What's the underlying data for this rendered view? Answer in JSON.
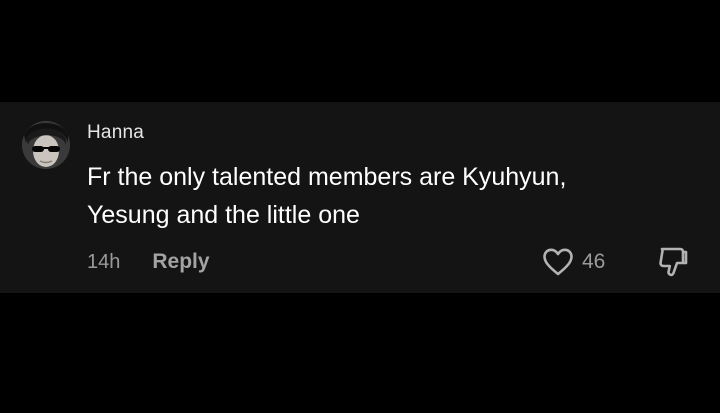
{
  "comment": {
    "username": "Hanna",
    "text_lines": [
      "Fr the only talented members are Kyuhyun,",
      "Yesung and the little one"
    ],
    "timestamp": "14h",
    "reply_label": "Reply",
    "like_count": "46",
    "icons": {
      "avatar": "avatar-photo",
      "like": "heart-outline-icon",
      "dislike": "thumbs-down-outline-icon"
    }
  },
  "colors": {
    "background": "#000000",
    "card": "#141414",
    "text_primary": "#ffffff",
    "text_secondary": "#9a9a9a"
  }
}
